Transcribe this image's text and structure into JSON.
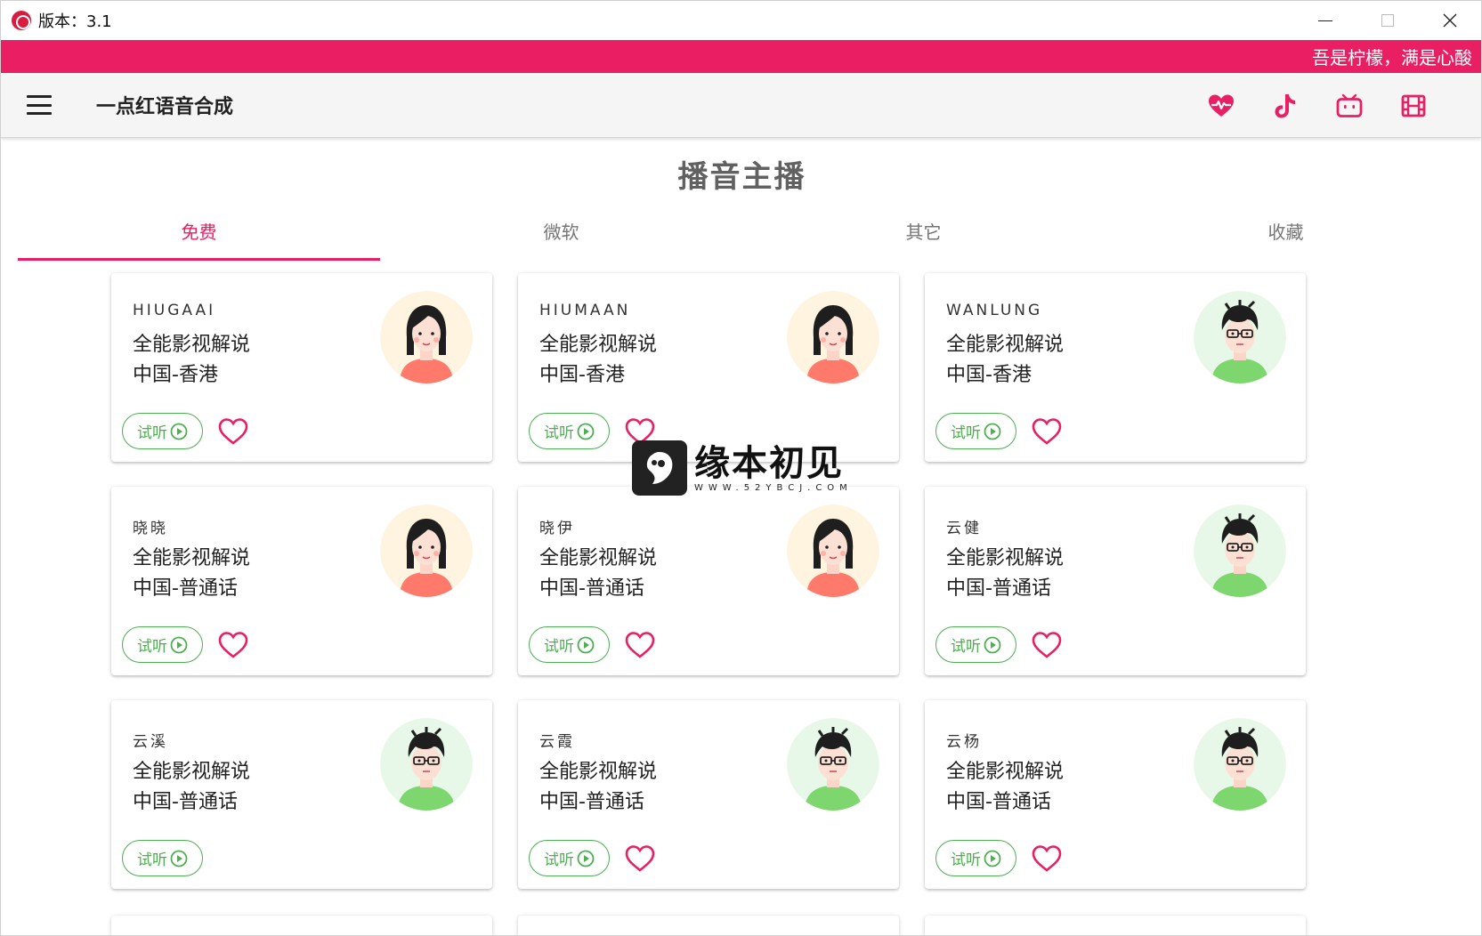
{
  "window": {
    "title": "版本：3.1"
  },
  "banner": {
    "text": "吾是柠檬，满是心酸"
  },
  "appbar": {
    "title": "一点红语音合成",
    "actions": [
      "heart-pulse-icon",
      "tiktok-icon",
      "bilibili-tv-icon",
      "film-icon"
    ],
    "accent": "#e91e63"
  },
  "page": {
    "heading": "播音主播"
  },
  "tabs": [
    {
      "label": "免费",
      "active": true
    },
    {
      "label": "微软",
      "active": false
    },
    {
      "label": "其它",
      "active": false
    },
    {
      "label": "收藏",
      "active": false
    }
  ],
  "play_label": "试听",
  "cards": [
    {
      "name": "HIUGAAI",
      "line1": "全能影视解说",
      "line2": "中国-香港",
      "avatar": "female",
      "heart": true
    },
    {
      "name": "HIUMAAN",
      "line1": "全能影视解说",
      "line2": "中国-香港",
      "avatar": "female",
      "heart": true
    },
    {
      "name": "WANLUNG",
      "line1": "全能影视解说",
      "line2": "中国-香港",
      "avatar": "male",
      "heart": true
    },
    {
      "name": "晓晓",
      "line1": "全能影视解说",
      "line2": "中国-普通话",
      "avatar": "female",
      "heart": true
    },
    {
      "name": "晓伊",
      "line1": "全能影视解说",
      "line2": "中国-普通话",
      "avatar": "female",
      "heart": true
    },
    {
      "name": "云健",
      "line1": "全能影视解说",
      "line2": "中国-普通话",
      "avatar": "male",
      "heart": true
    },
    {
      "name": "云溪",
      "line1": "全能影视解说",
      "line2": "中国-普通话",
      "avatar": "male",
      "heart": false
    },
    {
      "name": "云霞",
      "line1": "全能影视解说",
      "line2": "中国-普通话",
      "avatar": "male",
      "heart": true
    },
    {
      "name": "云杨",
      "line1": "全能影视解说",
      "line2": "中国-普通话",
      "avatar": "male",
      "heart": true
    }
  ],
  "watermark": {
    "title": "缘本初见",
    "subtitle": "WWW.52YBCJ.COM"
  },
  "colors": {
    "accent": "#e91e63",
    "play": "#4caf50",
    "female_bg": "#fff4e0",
    "male_bg": "#e8f8e8"
  }
}
